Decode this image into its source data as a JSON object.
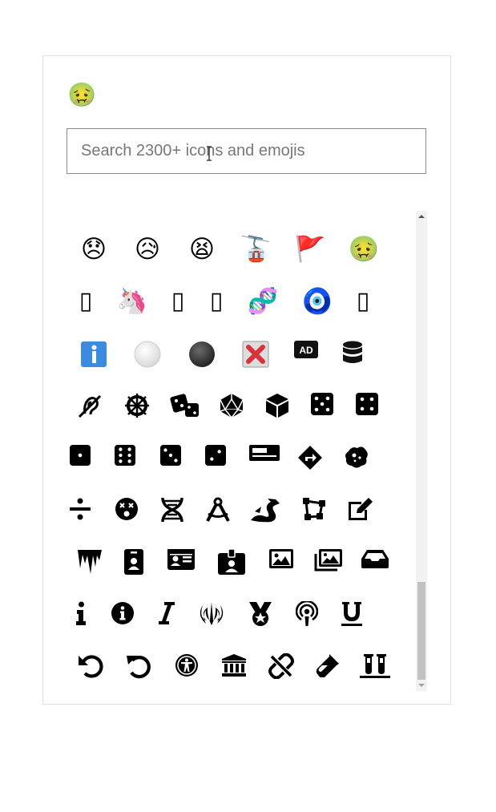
{
  "selected_icon": {
    "glyph": "🤢",
    "name": "nauseated-face"
  },
  "search": {
    "placeholder": "Search 2300+ icons and emojis",
    "value": ""
  },
  "rows": [
    [
      {
        "glyph": "😞",
        "name": "disappointed-face-icon"
      },
      {
        "glyph": "😥",
        "name": "sad-relieved-face-icon"
      },
      {
        "glyph": "😫",
        "name": "tired-face-icon"
      },
      {
        "glyph": "🚡",
        "name": "aerial-tramway-icon"
      },
      {
        "glyph": "🚩",
        "name": "triangular-flag-icon"
      },
      {
        "glyph": "🤢",
        "name": "nauseated-face-icon"
      }
    ],
    [
      {
        "glyph": "▯",
        "name": "missing-glyph-icon"
      },
      {
        "glyph": "🦄",
        "name": "unicorn-icon"
      },
      {
        "glyph": "▯",
        "name": "missing-glyph-icon"
      },
      {
        "glyph": "▯",
        "name": "missing-glyph-icon"
      },
      {
        "glyph": "🧬",
        "name": "dna-icon"
      },
      {
        "glyph": "🧿",
        "name": "nazar-amulet-icon"
      },
      {
        "glyph": "▯",
        "name": "missing-glyph-icon"
      }
    ],
    [
      {
        "glyph": "ℹ️",
        "name": "information-icon"
      },
      {
        "glyph": "⚪",
        "name": "white-circle-icon"
      },
      {
        "glyph": "⚫",
        "name": "black-circle-icon"
      },
      {
        "glyph": "❎",
        "name": "cross-mark-button-icon"
      },
      {
        "glyph": "",
        "name": "ad-icon"
      },
      {
        "glyph": "",
        "name": "database-icon"
      }
    ],
    [
      {
        "glyph": "",
        "name": "deaf-icon"
      },
      {
        "glyph": "☸",
        "name": "dharmachakra-icon"
      },
      {
        "glyph": "",
        "name": "dice-icon"
      },
      {
        "glyph": "",
        "name": "dice-d20-icon"
      },
      {
        "glyph": "",
        "name": "dice-d6-icon"
      },
      {
        "glyph": "",
        "name": "dice-five-icon"
      },
      {
        "glyph": "",
        "name": "dice-four-icon"
      }
    ],
    [
      {
        "glyph": "",
        "name": "dice-one-icon"
      },
      {
        "glyph": "",
        "name": "dice-six-icon"
      },
      {
        "glyph": "",
        "name": "dice-three-icon"
      },
      {
        "glyph": "",
        "name": "dice-two-icon"
      },
      {
        "glyph": "",
        "name": "digital-tachograph-icon"
      },
      {
        "glyph": "",
        "name": "directions-icon"
      },
      {
        "glyph": "",
        "name": "disease-icon"
      }
    ],
    [
      {
        "glyph": "÷",
        "name": "divide-icon"
      },
      {
        "glyph": "",
        "name": "dizzy-icon"
      },
      {
        "glyph": "",
        "name": "dna-strand-icon"
      },
      {
        "glyph": "",
        "name": "drafting-compass-icon"
      },
      {
        "glyph": "",
        "name": "dragon-icon"
      },
      {
        "glyph": "",
        "name": "draw-polygon-icon"
      },
      {
        "glyph": "",
        "name": "edit-icon"
      }
    ],
    [
      {
        "glyph": "",
        "name": "icicles-icon"
      },
      {
        "glyph": "",
        "name": "id-badge-icon"
      },
      {
        "glyph": "",
        "name": "id-card-icon"
      },
      {
        "glyph": "",
        "name": "id-card-alt-icon"
      },
      {
        "glyph": "",
        "name": "image-icon"
      },
      {
        "glyph": "",
        "name": "images-icon"
      },
      {
        "glyph": "",
        "name": "inbox-icon"
      }
    ],
    [
      {
        "glyph": "i",
        "name": "info-icon"
      },
      {
        "glyph": "",
        "name": "info-circle-icon"
      },
      {
        "glyph": "I",
        "name": "italic-icon"
      },
      {
        "glyph": "",
        "name": "jedi-order-icon"
      },
      {
        "glyph": "",
        "name": "medal-icon"
      },
      {
        "glyph": "",
        "name": "podcast-icon"
      },
      {
        "glyph": "U",
        "name": "underline-icon"
      }
    ],
    [
      {
        "glyph": "",
        "name": "undo-icon"
      },
      {
        "glyph": "",
        "name": "undo-alt-icon"
      },
      {
        "glyph": "",
        "name": "universal-access-icon"
      },
      {
        "glyph": "",
        "name": "university-icon"
      },
      {
        "glyph": "",
        "name": "unlink-icon"
      },
      {
        "glyph": "",
        "name": "vial-icon"
      },
      {
        "glyph": "",
        "name": "vials-icon"
      }
    ]
  ],
  "scrollbar": {
    "position_fraction": 0.78
  }
}
